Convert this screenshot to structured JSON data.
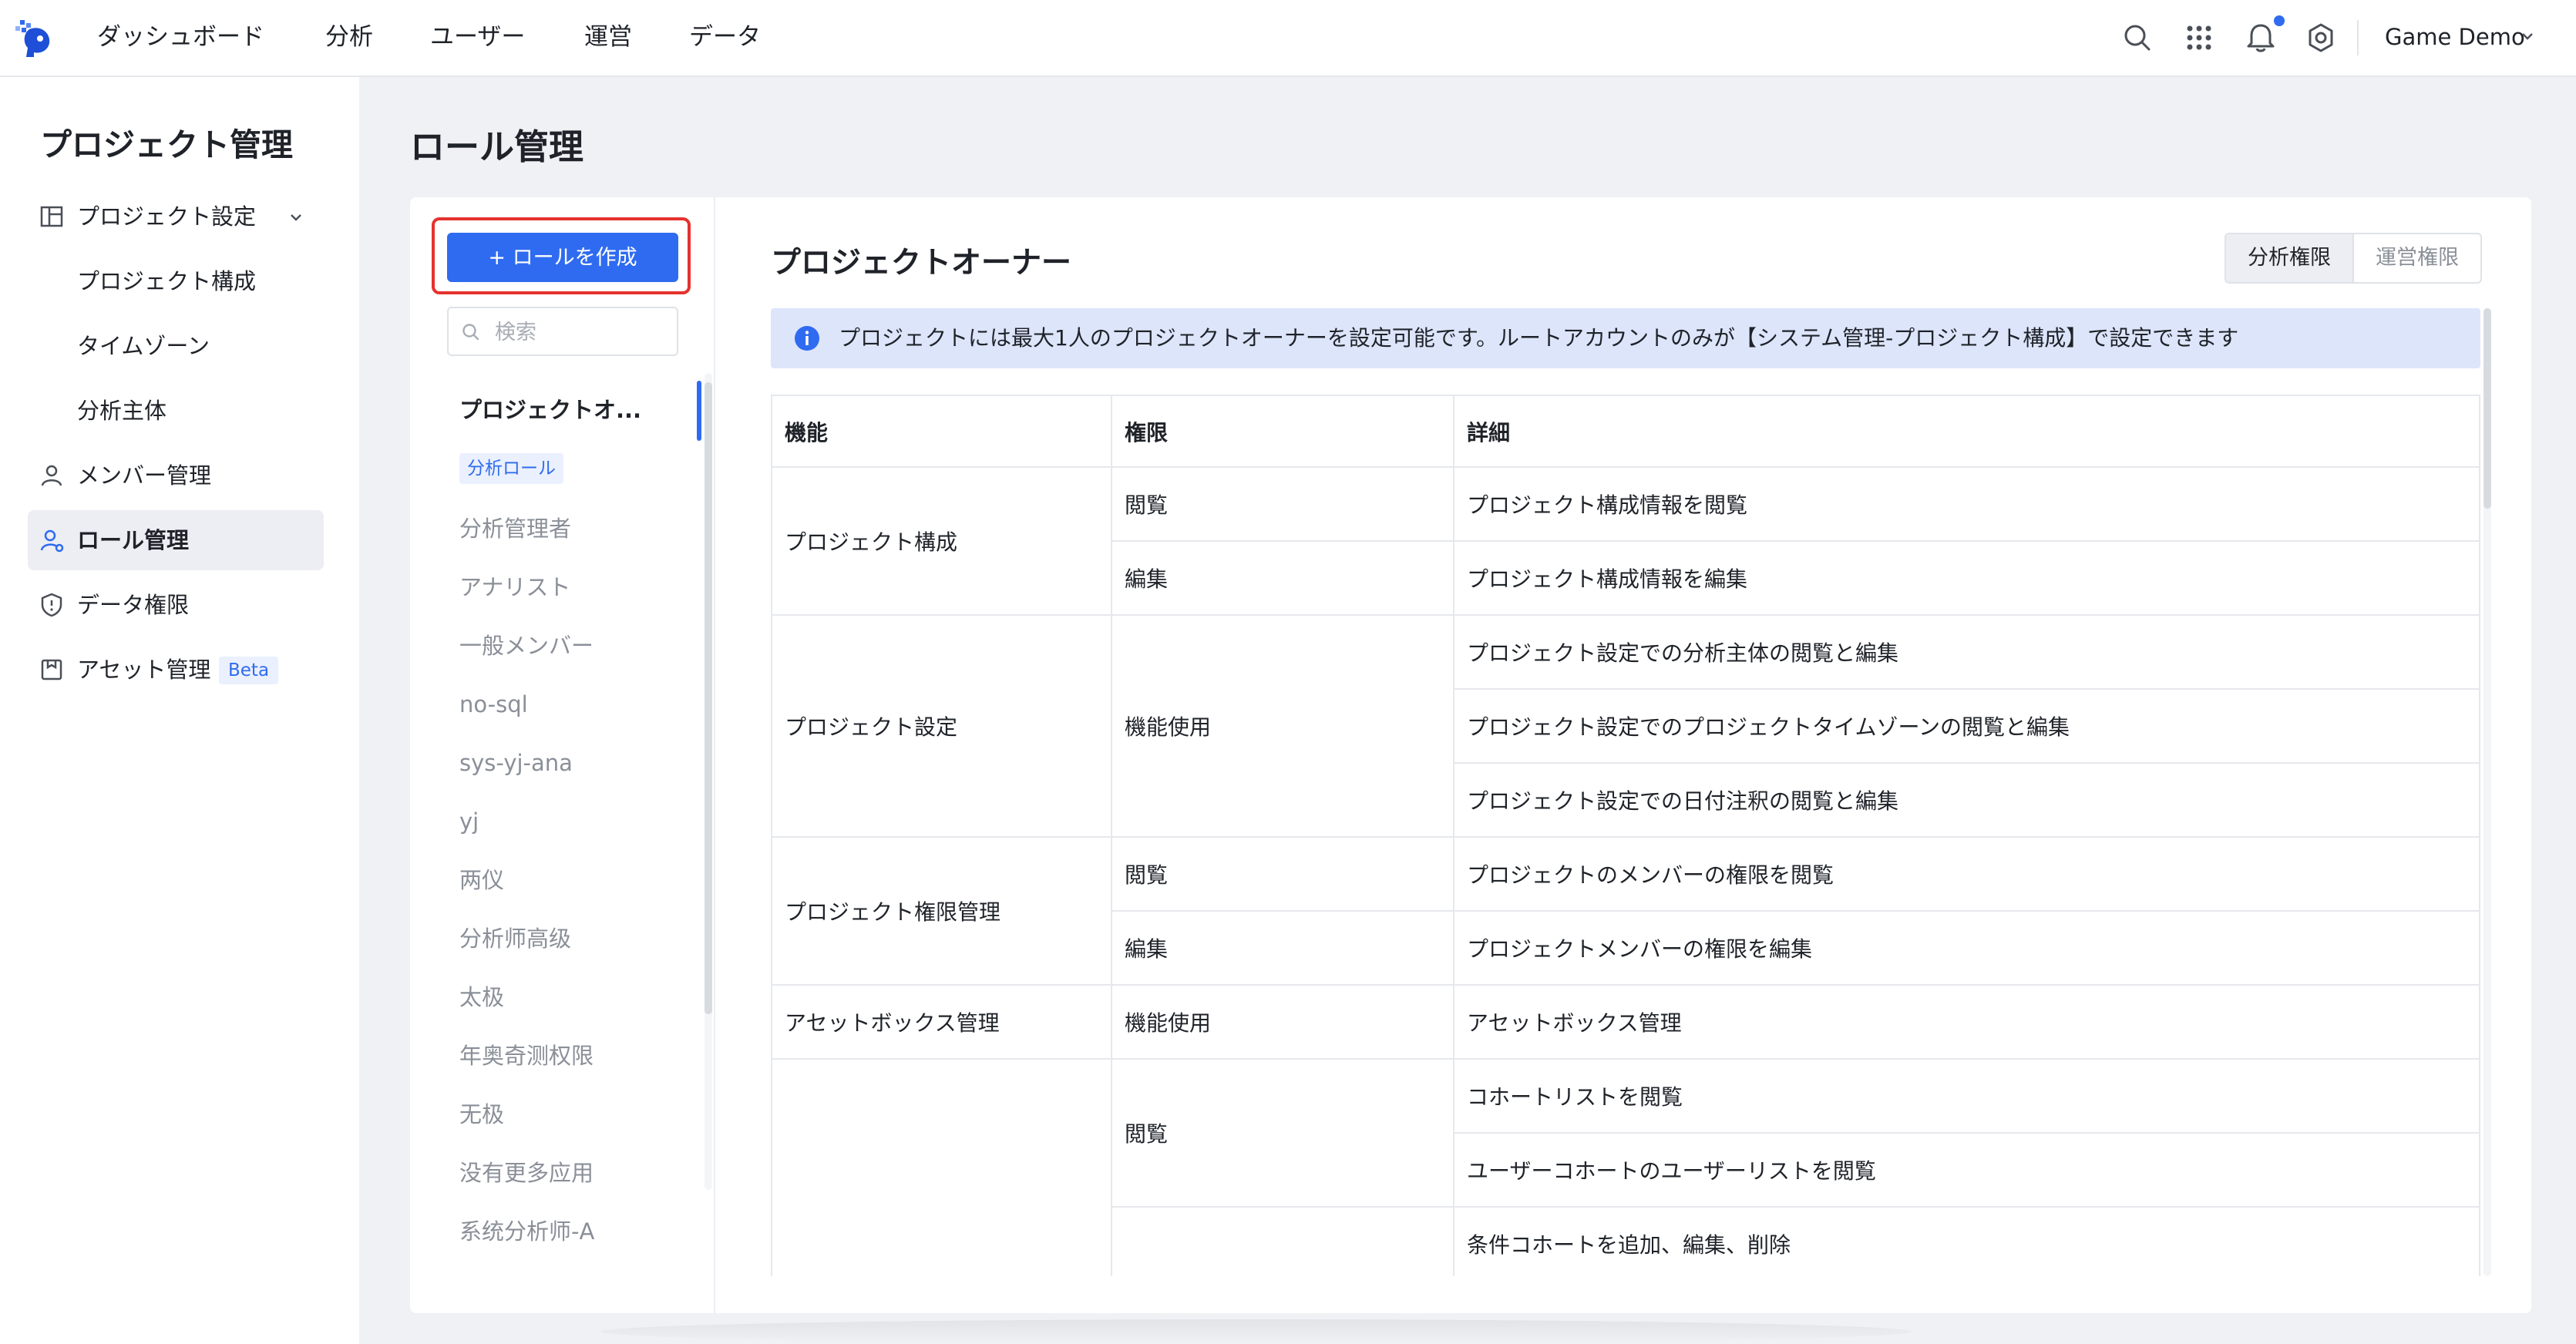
{
  "top_nav": {
    "items": [
      "ダッシュボード",
      "分析",
      "ユーザー",
      "運営",
      "データ"
    ],
    "user": "Game Demo",
    "icons": [
      "search-icon",
      "apps-grid-icon",
      "bell-icon",
      "settings-icon"
    ]
  },
  "sidebar": {
    "title": "プロジェクト管理",
    "items": [
      {
        "label": "プロジェクト設定",
        "icon": "project-settings-icon"
      },
      {
        "label": "プロジェクト構成"
      },
      {
        "label": "タイムゾーン"
      },
      {
        "label": "分析主体"
      },
      {
        "label": "メンバー管理",
        "icon": "user-icon"
      },
      {
        "label": "ロール管理",
        "icon": "role-icon"
      },
      {
        "label": "データ権限",
        "icon": "shield-icon"
      },
      {
        "label": "アセット管理",
        "icon": "asset-icon",
        "badge": "Beta"
      }
    ]
  },
  "page": {
    "title": "ロール管理"
  },
  "roles": {
    "create_button": "+ ロールを作成",
    "search_placeholder": "検索",
    "active": "プロジェクトオ...",
    "tag": "分析ロール",
    "items": [
      "分析管理者",
      "アナリスト",
      "一般メンバー",
      "no-sql",
      "sys-yj-ana",
      "yj",
      "两仪",
      "分析师高级",
      "太极",
      "年奥奇测权限",
      "无极",
      "没有更多应用",
      "系统分析师-A"
    ]
  },
  "detail": {
    "title": "プロジェクトオーナー",
    "tabs": [
      "分析権限",
      "運営権限"
    ],
    "active_tab": "分析権限",
    "info": "プロジェクトには最大1人のプロジェクトオーナーを設定可能です。ルートアカウントのみが【システム管理-プロジェクト構成】で設定できます",
    "table": {
      "headers": [
        "機能",
        "権限",
        "詳細"
      ],
      "rows": [
        {
          "feature": "プロジェクト構成",
          "perm": "閲覧",
          "detail": "プロジェクト構成情報を閲覧"
        },
        {
          "feature": "",
          "perm": "編集",
          "detail": "プロジェクト構成情報を編集"
        },
        {
          "feature": "プロジェクト設定",
          "perm": "機能使用",
          "detail": "プロジェクト設定での分析主体の閲覧と編集"
        },
        {
          "feature": "",
          "perm": "",
          "detail": "プロジェクト設定でのプロジェクトタイムゾーンの閲覧と編集"
        },
        {
          "feature": "",
          "perm": "",
          "detail": "プロジェクト設定での日付注釈の閲覧と編集"
        },
        {
          "feature": "プロジェクト権限管理",
          "perm": "閲覧",
          "detail": "プロジェクトのメンバーの権限を閲覧"
        },
        {
          "feature": "",
          "perm": "編集",
          "detail": "プロジェクトメンバーの権限を編集"
        },
        {
          "feature": "アセットボックス管理",
          "perm": "機能使用",
          "detail": "アセットボックス管理"
        },
        {
          "feature": "",
          "perm": "閲覧",
          "detail": "コホートリストを閲覧"
        },
        {
          "feature": "",
          "perm": "",
          "detail": "ユーザーコホートのユーザーリストを閲覧"
        },
        {
          "feature": "",
          "perm": "",
          "detail": "条件コホートを追加、編集、削除"
        }
      ]
    }
  }
}
